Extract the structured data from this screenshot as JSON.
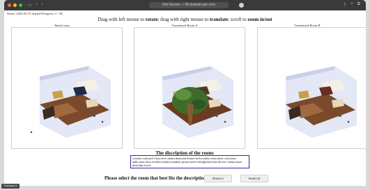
{
  "browser": {
    "address": "Not Secure — ffs.tianbaicuan.com",
    "left_icons": [
      "sidebar-icon",
      "back-icon",
      "forward-icon"
    ],
    "right_icons": [
      "share-icon",
      "new-tab-icon",
      "tabs-icon"
    ]
  },
  "series_progress": "Series: 2022-03-15 id panel Progress: 1 / 30,",
  "instructions": {
    "part1": "Drag with left mouse to ",
    "rotate": "rotate",
    "part2": "; drag with right mouse to ",
    "translate": "translate",
    "part3": "; scroll to ",
    "zoom": "zoom in/out"
  },
  "panels": [
    {
      "title": "Initial room"
    },
    {
      "title": "Transferred Room A"
    },
    {
      "title": "Transferred Room B"
    }
  ],
  "description": {
    "title": "The discription of the room:",
    "text": "wooden wall,steel floor,steel cabinet,diamond texture bed,wooden chair,fabric sofa,stone table,stone door,wooden window,rainbow picture,steel refridgerator,blue shower curtain,stone desk,blue towel"
  },
  "selection": {
    "prompt": "Please select the room that best fits the description:",
    "room_a": "Room A",
    "room_b": "Room B"
  },
  "feedback_label": "Feedback & Help",
  "colors": {
    "chrome": "#3a3a3c",
    "desc_border": "#2a2aa8",
    "room_wall": "#dfe3f4",
    "floor_wood": "#6b3b22"
  }
}
